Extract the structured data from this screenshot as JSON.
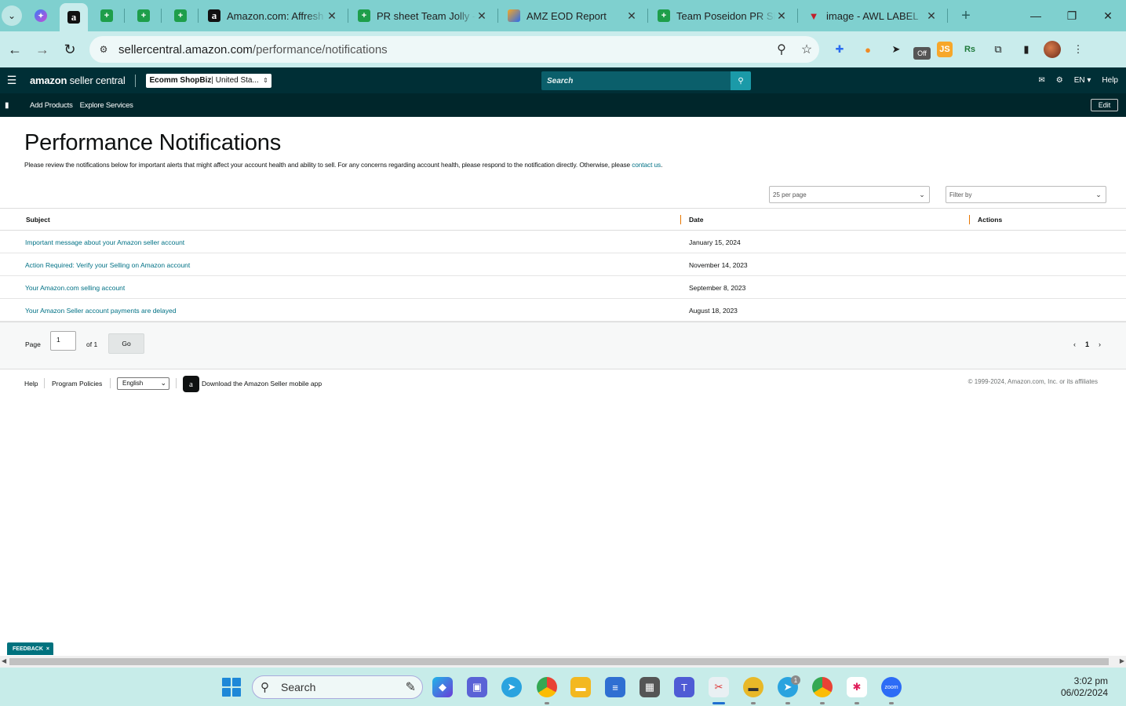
{
  "browser": {
    "tabs": [
      {
        "title": "Amazon.com: Affresh W",
        "icon": "amazon-icon"
      },
      {
        "title": "PR sheet Team Jolly - G",
        "icon": "sheets-icon"
      },
      {
        "title": "AMZ EOD Report",
        "icon": "eod-icon"
      },
      {
        "title": "Team Poseidon PR She",
        "icon": "sheets-icon"
      },
      {
        "title": "image - AWL LABEL",
        "icon": "awl-icon"
      }
    ],
    "url_host": "sellercentral.amazon.com",
    "url_path": "/performance/notifications",
    "extension_js": "JS",
    "extension_off": "Off",
    "extension_rs": "Rs"
  },
  "header": {
    "logo_bold": "amazon",
    "logo_rest": " seller central",
    "account_bold": "Ecomm ShopBiz",
    "account_rest": " | United Sta...",
    "search_placeholder": "Search",
    "language": "EN",
    "help": "Help"
  },
  "subnav": {
    "links": [
      "Add Products",
      "Explore Services"
    ],
    "edit": "Edit"
  },
  "page": {
    "title": "Performance Notifications",
    "description": "Please review the notifications below for important alerts that might affect your account health and ability to sell. For any concerns regarding account health, please respond to the notification directly. Otherwise, please ",
    "contact_link": "contact us",
    "description_end": ".",
    "per_page": "25 per page",
    "filter_placeholder": "Filter by"
  },
  "table": {
    "columns": [
      "Subject",
      "Date",
      "Actions"
    ],
    "rows": [
      {
        "subject": "Important message about your Amazon seller account",
        "date": "January 15, 2024"
      },
      {
        "subject": "Action Required: Verify your Selling on Amazon account",
        "date": "November 14, 2023"
      },
      {
        "subject": "Your Amazon.com selling account",
        "date": "September 8, 2023"
      },
      {
        "subject": "Your Amazon Seller account payments are delayed",
        "date": "August 18, 2023"
      }
    ]
  },
  "pagination": {
    "page_label": "Page",
    "current": "1",
    "of_label": "of 1",
    "go": "Go",
    "page_number": "1"
  },
  "footer": {
    "help": "Help",
    "policies": "Program Policies",
    "language": "English",
    "app_text": "Download the Amazon Seller mobile app",
    "copyright": "© 1999-2024, Amazon.com, Inc. or its affiliates"
  },
  "feedback": {
    "label": "FEEDBACK",
    "close": "×"
  },
  "taskbar": {
    "search": "Search",
    "time": "3:02 pm",
    "date": "06/02/2024",
    "telegram_badge": "1"
  },
  "colors": {
    "browser_frame": "#7fd0cf",
    "header_bg": "#002f36",
    "link": "#007185",
    "column_divider": "#e77600"
  }
}
